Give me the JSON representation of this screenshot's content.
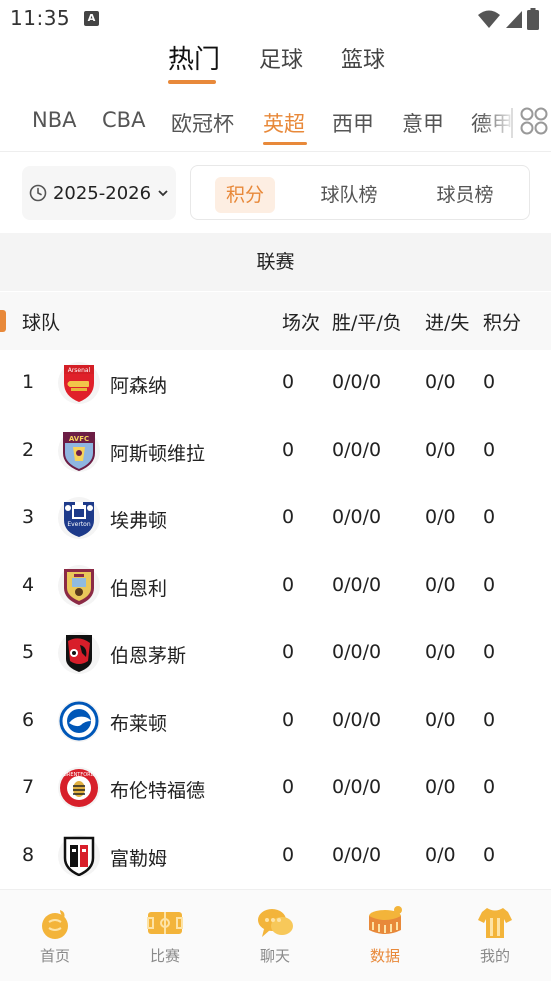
{
  "status_bar": {
    "time": "11:35",
    "notification_letter": "A"
  },
  "main_tabs": [
    {
      "label": "热门",
      "active": true
    },
    {
      "label": "足球",
      "active": false
    },
    {
      "label": "篮球",
      "active": false
    }
  ],
  "league_tabs": [
    {
      "label": "NBA",
      "active": false
    },
    {
      "label": "CBA",
      "active": false
    },
    {
      "label": "欧冠杯",
      "active": false
    },
    {
      "label": "英超",
      "active": true
    },
    {
      "label": "西甲",
      "active": false
    },
    {
      "label": "意甲",
      "active": false
    },
    {
      "label": "德甲",
      "active": false
    }
  ],
  "season": {
    "label": "2025-2026"
  },
  "segments": [
    {
      "label": "积分",
      "active": true
    },
    {
      "label": "球队榜",
      "active": false
    },
    {
      "label": "球员榜",
      "active": false
    }
  ],
  "section_title": "联赛",
  "table": {
    "headers": {
      "team": "球队",
      "played": "场次",
      "wdl": "胜/平/负",
      "goals": "进/失",
      "points": "积分"
    },
    "rows": [
      {
        "rank": "1",
        "team": "阿森纳",
        "played": "0",
        "wdl": "0/0/0",
        "goals": "0/0",
        "points": "0",
        "logo": "arsenal-crest"
      },
      {
        "rank": "2",
        "team": "阿斯顿维拉",
        "played": "0",
        "wdl": "0/0/0",
        "goals": "0/0",
        "points": "0",
        "logo": "aston-villa-crest"
      },
      {
        "rank": "3",
        "team": "埃弗顿",
        "played": "0",
        "wdl": "0/0/0",
        "goals": "0/0",
        "points": "0",
        "logo": "everton-crest"
      },
      {
        "rank": "4",
        "team": "伯恩利",
        "played": "0",
        "wdl": "0/0/0",
        "goals": "0/0",
        "points": "0",
        "logo": "burnley-crest"
      },
      {
        "rank": "5",
        "team": "伯恩茅斯",
        "played": "0",
        "wdl": "0/0/0",
        "goals": "0/0",
        "points": "0",
        "logo": "bournemouth-crest"
      },
      {
        "rank": "6",
        "team": "布莱顿",
        "played": "0",
        "wdl": "0/0/0",
        "goals": "0/0",
        "points": "0",
        "logo": "brighton-crest"
      },
      {
        "rank": "7",
        "team": "布伦特福德",
        "played": "0",
        "wdl": "0/0/0",
        "goals": "0/0",
        "points": "0",
        "logo": "brentford-crest"
      },
      {
        "rank": "8",
        "team": "富勒姆",
        "played": "0",
        "wdl": "0/0/0",
        "goals": "0/0",
        "points": "0",
        "logo": "fulham-crest"
      }
    ]
  },
  "crest_text": {
    "arsenal": "Arsenal",
    "aston_villa": "AVFC",
    "everton": "Everton",
    "brentford": "BRENTFORD"
  },
  "bottom_nav": [
    {
      "label": "首页",
      "icon": "home-icon",
      "active": false
    },
    {
      "label": "比赛",
      "icon": "pitch-icon",
      "active": false
    },
    {
      "label": "聊天",
      "icon": "chat-icon",
      "active": false
    },
    {
      "label": "数据",
      "icon": "stadium-icon",
      "active": true
    },
    {
      "label": "我的",
      "icon": "jersey-icon",
      "active": false
    }
  ],
  "colors": {
    "accent": "#e8893a",
    "accent_light": "#fdeee2",
    "icon_gold": "#f3b43a"
  }
}
